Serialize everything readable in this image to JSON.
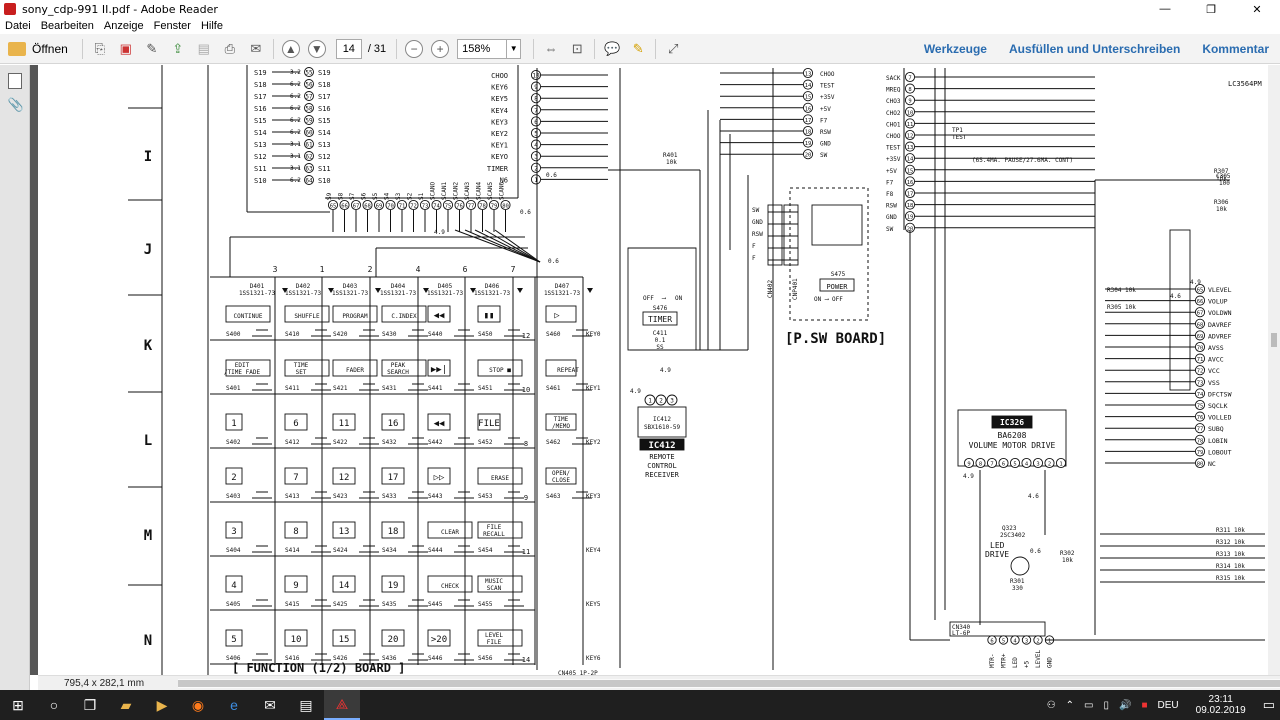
{
  "window": {
    "title": "sony_cdp-991 II.pdf - Adobe Reader",
    "min": "—",
    "max": "❐",
    "close": "✕"
  },
  "menu": [
    "Datei",
    "Bearbeiten",
    "Anzeige",
    "Fenster",
    "Hilfe"
  ],
  "toolbar": {
    "open_label": "Öffnen",
    "page_current": "14",
    "page_total": "/ 31",
    "zoom": "158%",
    "tools": "Werkzeuge",
    "fill_sign": "Ausfüllen und Unterschreiben",
    "comment": "Kommentar"
  },
  "status": {
    "dimensions": "795,4 x 282,1 mm"
  },
  "taskbar": {
    "lang": "DEU",
    "time": "23:11",
    "date": "09.02.2019"
  },
  "schematic": {
    "row_labels": [
      "I",
      "J",
      "K",
      "L",
      "M",
      "N"
    ],
    "left_pins": [
      [
        "S19",
        "3.2",
        "55",
        "S19"
      ],
      [
        "S18",
        "6.2",
        "56",
        "S18"
      ],
      [
        "S17",
        "6.2",
        "57",
        "S17"
      ],
      [
        "S16",
        "6.2",
        "58",
        "S16"
      ],
      [
        "S15",
        "6.2",
        "59",
        "S15"
      ],
      [
        "S14",
        "6.2",
        "60",
        "S14"
      ],
      [
        "S13",
        "3.1",
        "61",
        "S13"
      ],
      [
        "S12",
        "3.1",
        "62",
        "S12"
      ],
      [
        "S11",
        "3.1",
        "63",
        "S11"
      ],
      [
        "S10",
        "6.2",
        "64",
        "S10"
      ]
    ],
    "right_pins": [
      [
        "CHOO",
        "10"
      ],
      [
        "KEY6",
        "9"
      ],
      [
        "KEY5",
        "8"
      ],
      [
        "KEY4",
        "7"
      ],
      [
        "KEY3",
        "6"
      ],
      [
        "KEY2",
        "5"
      ],
      [
        "KEY1",
        "4"
      ],
      [
        "KEYO",
        "3"
      ],
      [
        "TIMER",
        "2"
      ],
      [
        "N6",
        "1"
      ]
    ],
    "bottom_pins": [
      "65",
      "66",
      "67",
      "68",
      "69",
      "70",
      "71",
      "72",
      "73",
      "74",
      "75",
      "76",
      "77",
      "78",
      "79",
      "80"
    ],
    "bottom_pin_names": [
      "S9",
      "S8",
      "S7",
      "S6",
      "S5",
      "S4",
      "S3",
      "S2",
      "S1",
      "SCANO",
      "SCAN1",
      "SCAN2",
      "SCAN3",
      "SCAN4",
      "SCAN5",
      "SCAN6"
    ],
    "diodes": [
      {
        "ref": "D401",
        "part": "1SS1321-73"
      },
      {
        "ref": "D402",
        "part": "1SS1321-73"
      },
      {
        "ref": "D403",
        "part": "1SS1321-73"
      },
      {
        "ref": "D404",
        "part": "1SS1321-73"
      },
      {
        "ref": "D405",
        "part": "1SS1321-73"
      },
      {
        "ref": "D406",
        "part": "1SS1321-73"
      },
      {
        "ref": "D407",
        "part": "1SS1321-73"
      }
    ],
    "column_numbers": [
      "3",
      "1",
      "2",
      "4",
      "6",
      "7"
    ],
    "key_rows": [
      {
        "cells": [
          [
            "CONTINUE",
            "S400"
          ],
          [
            "SHUFFLE",
            "S410"
          ],
          [
            "PROGRAM",
            "S420"
          ],
          [
            "C.INDEX",
            "S430"
          ],
          [
            "◀◀",
            "S440"
          ],
          [
            "▮▮",
            "S450"
          ],
          [
            "▷",
            "S460"
          ]
        ],
        "key": "KEY0",
        "num": "12"
      },
      {
        "cells": [
          [
            "EDIT /TIME FADE",
            "S401"
          ],
          [
            "TIME SET",
            "S411"
          ],
          [
            "FADER",
            "S421"
          ],
          [
            "PEAK SEARCH",
            "S431"
          ],
          [
            "▶▶|",
            "S441"
          ],
          [
            "STOP ■",
            "S451"
          ],
          [
            "REPEAT",
            "S461"
          ]
        ],
        "key": "KEY1",
        "num": "10"
      },
      {
        "cells": [
          [
            "1",
            "S402"
          ],
          [
            "6",
            "S412"
          ],
          [
            "11",
            "S422"
          ],
          [
            "16",
            "S432"
          ],
          [
            "◀◀",
            "S442"
          ],
          [
            "FILE",
            "S452"
          ],
          [
            "TIME /MEMO",
            "S462"
          ]
        ],
        "key": "KEY2",
        "num": "8"
      },
      {
        "cells": [
          [
            "2",
            "S403"
          ],
          [
            "7",
            "S413"
          ],
          [
            "12",
            "S423"
          ],
          [
            "17",
            "S433"
          ],
          [
            "▷▷",
            "S443"
          ],
          [
            "ERASE",
            "S453"
          ],
          [
            "OPEN/ CLOSE",
            "S463"
          ]
        ],
        "key": "KEY3",
        "num": "9"
      },
      {
        "cells": [
          [
            "3",
            "S404"
          ],
          [
            "8",
            "S414"
          ],
          [
            "13",
            "S424"
          ],
          [
            "18",
            "S434"
          ],
          [
            "CLEAR",
            "S444"
          ],
          [
            "FILE RECALL",
            "S454"
          ],
          [
            "",
            ""
          ]
        ],
        "key": "KEY4",
        "num": "11"
      },
      {
        "cells": [
          [
            "4",
            "S405"
          ],
          [
            "9",
            "S415"
          ],
          [
            "14",
            "S425"
          ],
          [
            "19",
            "S435"
          ],
          [
            "CHECK",
            "S445"
          ],
          [
            "MUSIC SCAN",
            "S455"
          ],
          [
            "",
            ""
          ]
        ],
        "key": "KEY5",
        "num": ""
      },
      {
        "cells": [
          [
            "5",
            "S406"
          ],
          [
            "10",
            "S416"
          ],
          [
            "15",
            "S426"
          ],
          [
            "20",
            "S436"
          ],
          [
            ">20",
            "S446"
          ],
          [
            "LEVEL FILE",
            "S456"
          ],
          [
            "",
            ""
          ]
        ],
        "key": "KEY6",
        "num": "14"
      }
    ],
    "function_board": "[ FUNCTION (1/2) BOARD ]",
    "cn405": "CN405 1P-2P",
    "r401": {
      "ref": "R401",
      "val": "10k"
    },
    "s476": {
      "off": "OFF",
      "on": "ON",
      "ref": "S476",
      "label": "TIMER"
    },
    "c411": {
      "ref": "C411",
      "v1": "0.1",
      "v2": "SS"
    },
    "ic412": {
      "name": "IC412",
      "part": "SBX1610-59",
      "desc1": "REMOTE",
      "desc2": "CONTROL",
      "desc3": "RECEIVER",
      "v": "4.9"
    },
    "cn402": {
      "ref": "CN402",
      "pins": [
        "SW",
        "GND",
        "RSW",
        "F",
        "F"
      ]
    },
    "cnp401": {
      "ref": "CNP401"
    },
    "s475": {
      "ref": "S475",
      "label": "POWER",
      "on": "ON",
      "off": "OFF"
    },
    "psw_board": "[P.SW BOARD]",
    "mid_connector": [
      "CHOO",
      "TEST",
      "+35V",
      "+5V",
      "F7",
      "RSW",
      "GND",
      "SW"
    ],
    "mid_connector_nums": [
      "13",
      "14",
      "15",
      "16",
      "17",
      "18",
      "19",
      "20"
    ],
    "right_conn_names": [
      "SACK",
      "MREQ",
      "CHO3",
      "CHO2",
      "CHO1",
      "CHOO",
      "TEST",
      "+35V",
      "+5V",
      "F7",
      "F8",
      "RSW",
      "GND",
      "SW"
    ],
    "right_conn_nums": [
      "7",
      "8",
      "9",
      "10",
      "11",
      "12",
      "13",
      "14",
      "15",
      "16",
      "17",
      "18",
      "19",
      "20"
    ],
    "tp1": {
      "ref": "TP1",
      "label": "TEST",
      "note": "(65.4MA. PAUSE/27.6MA. CONT)"
    },
    "ic326": {
      "name": "IC326",
      "part": "BA6208",
      "desc": "VOLUME MOTOR DRIVE"
    },
    "lc3564": "LC3564PM",
    "r_right": [
      {
        "ref": "C305",
        "val": "100"
      },
      {
        "ref": "R307",
        "val": "10k"
      },
      {
        "ref": "R306",
        "val": "10k"
      },
      {
        "ref": "R308",
        "val": "10k"
      }
    ],
    "ic_right_pins": [
      [
        "65",
        "VLEVEL"
      ],
      [
        "66",
        "VOLUP"
      ],
      [
        "67",
        "VOLDWN"
      ],
      [
        "68",
        "DAVREF"
      ],
      [
        "69",
        "ADVREF"
      ],
      [
        "70",
        "AVSS"
      ],
      [
        "71",
        "AVCC"
      ],
      [
        "72",
        "VCC"
      ],
      [
        "73",
        "VSS"
      ],
      [
        "74",
        "DFCTSW"
      ],
      [
        "75",
        "SQCLK"
      ],
      [
        "76",
        "VOLLED"
      ],
      [
        "77",
        "SUBQ"
      ],
      [
        "78",
        "LOBIN"
      ],
      [
        "79",
        "LOBOUT"
      ],
      [
        "80",
        "NC"
      ]
    ],
    "r304": {
      "ref": "R304",
      "val": "10k"
    },
    "r305": {
      "ref": "R305",
      "val": "10k"
    },
    "bottom_resistors": [
      {
        "ref": "R311",
        "val": "10k"
      },
      {
        "ref": "R312",
        "val": "10k"
      },
      {
        "ref": "R313",
        "val": "10k"
      },
      {
        "ref": "R314",
        "val": "10k"
      },
      {
        "ref": "R315",
        "val": "10k"
      }
    ],
    "q323": {
      "ref": "Q323",
      "part": "2SC3402",
      "label1": "LED",
      "label2": "DRIVE"
    },
    "r302": {
      "ref": "R302",
      "val": "10k"
    },
    "r301": {
      "ref": "R301",
      "val": "330"
    },
    "cn340": {
      "ref": "CN340",
      "type": "LT-6P",
      "pins": [
        "MTR-",
        "MTR+",
        "LED",
        "+5",
        "LEVEL",
        "GND"
      ]
    },
    "volt_49": "4.9",
    "volt_46": "4.6",
    "volt_06": "0.6"
  }
}
